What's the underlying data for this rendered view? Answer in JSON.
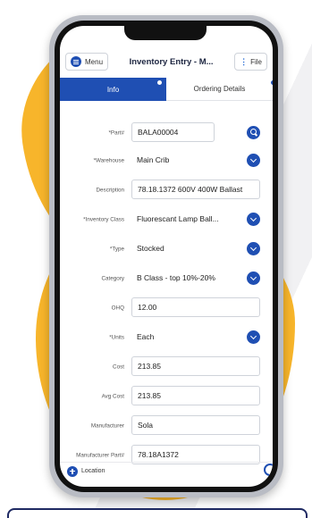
{
  "app": {
    "menu_label": "Menu",
    "title": "Inventory Entry - M...",
    "file_label": "File",
    "kebab": "⋮"
  },
  "tabs": [
    {
      "label": "Info",
      "active": true
    },
    {
      "label": "Ordering Details",
      "active": false
    }
  ],
  "form": {
    "fields": [
      {
        "label": "*Part#",
        "value": "BALA00004",
        "kind": "input-search"
      },
      {
        "label": "*Warehouse",
        "value": "Main Crib",
        "kind": "select"
      },
      {
        "label": "Description",
        "value": "78.18.1372 600V 400W Ballast",
        "kind": "input"
      },
      {
        "label": "*Inventory Class",
        "value": "Fluorescant Lamp Ball...",
        "kind": "select"
      },
      {
        "label": "*Type",
        "value": "Stocked",
        "kind": "select"
      },
      {
        "label": "Category",
        "value": "B Class - top 10%-20%",
        "kind": "select"
      },
      {
        "label": "OHQ",
        "value": "12.00",
        "kind": "input"
      },
      {
        "label": "*Units",
        "value": "Each",
        "kind": "select"
      },
      {
        "label": "Cost",
        "value": "213.85",
        "kind": "input"
      },
      {
        "label": "Avg Cost",
        "value": "213.85",
        "kind": "input"
      },
      {
        "label": "Manufacturer",
        "value": "Sola",
        "kind": "input"
      },
      {
        "label": "Manufacturer Part#",
        "value": "78.18A1372",
        "kind": "input"
      }
    ]
  },
  "footer": {
    "location_label": "Location"
  },
  "colors": {
    "accent": "#1f4fb3",
    "brand_yellow": "#f7b52b",
    "frame_navy": "#1f2a63"
  }
}
